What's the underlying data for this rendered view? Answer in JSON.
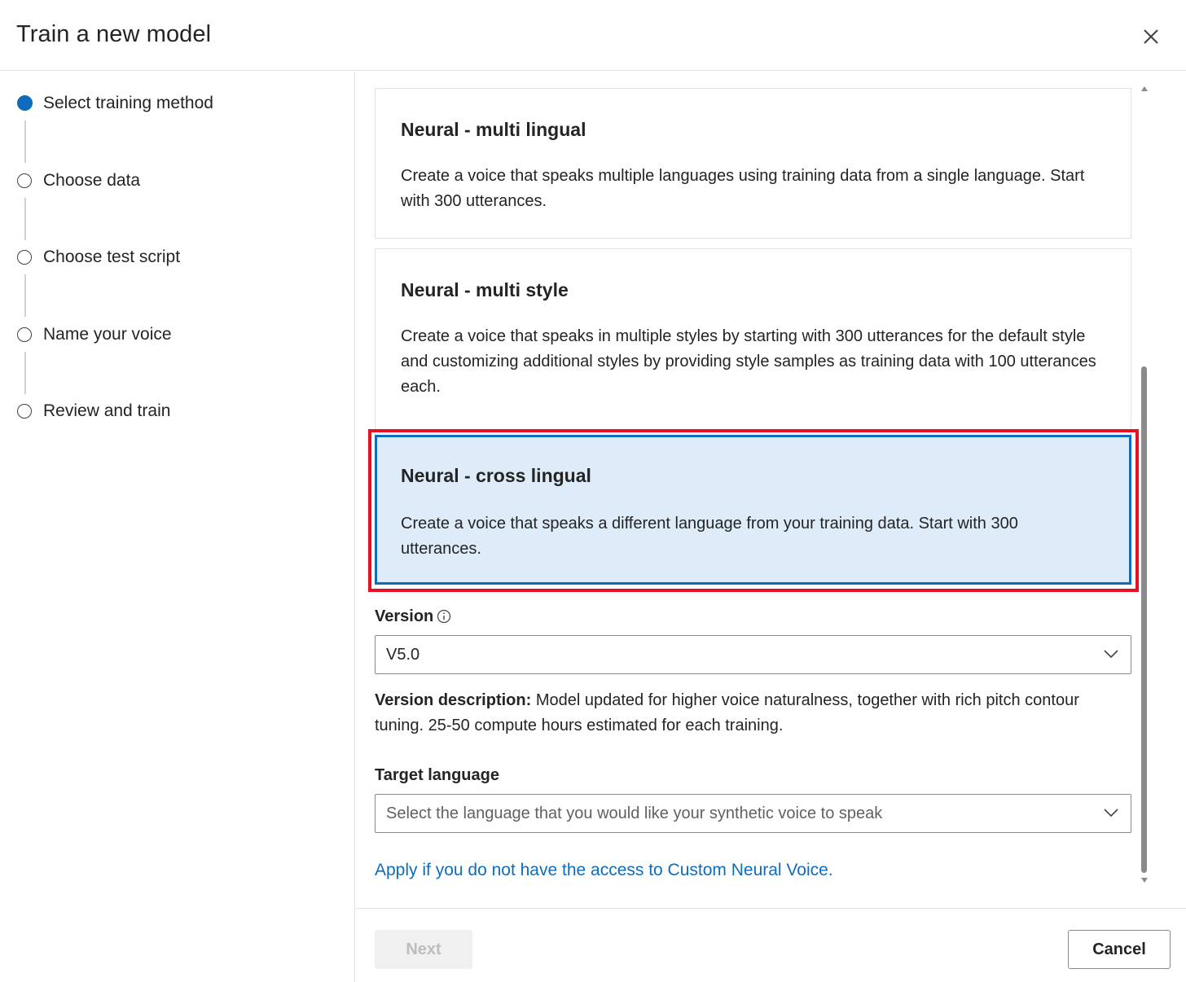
{
  "dialog": {
    "title": "Train a new model"
  },
  "steps": [
    {
      "label": "Select training method",
      "active": true
    },
    {
      "label": "Choose data",
      "active": false
    },
    {
      "label": "Choose test script",
      "active": false
    },
    {
      "label": "Name your voice",
      "active": false
    },
    {
      "label": "Review and train",
      "active": false
    }
  ],
  "cards": [
    {
      "title": "Neural - multi lingual",
      "description": "Create a voice that speaks multiple languages using training data from a single language. Start with 300 utterances.",
      "selected": false
    },
    {
      "title": "Neural - multi style",
      "description": "Create a voice that speaks in multiple styles by starting with 300 utterances for the default style and customizing additional styles by providing style samples as training data with 100 utterances each.",
      "selected": false
    },
    {
      "title": "Neural - cross lingual",
      "description": "Create a voice that speaks a different language from your training data. Start with 300 utterances.",
      "selected": true
    }
  ],
  "version": {
    "label": "Version",
    "value": "V5.0",
    "description_label": "Version description:",
    "description_text": " Model updated for higher voice naturalness, together with rich pitch contour tuning. 25-50 compute hours estimated for each training."
  },
  "target_language": {
    "label": "Target language",
    "placeholder": "Select the language that you would like your synthetic voice to speak"
  },
  "apply_link": "Apply if you do not have the access to Custom Neural Voice.",
  "footer": {
    "next_label": "Next",
    "cancel_label": "Cancel"
  },
  "colors": {
    "accent": "#0f6cbd",
    "selected_background": "#deecf9",
    "highlight_outline": "#e81123"
  }
}
